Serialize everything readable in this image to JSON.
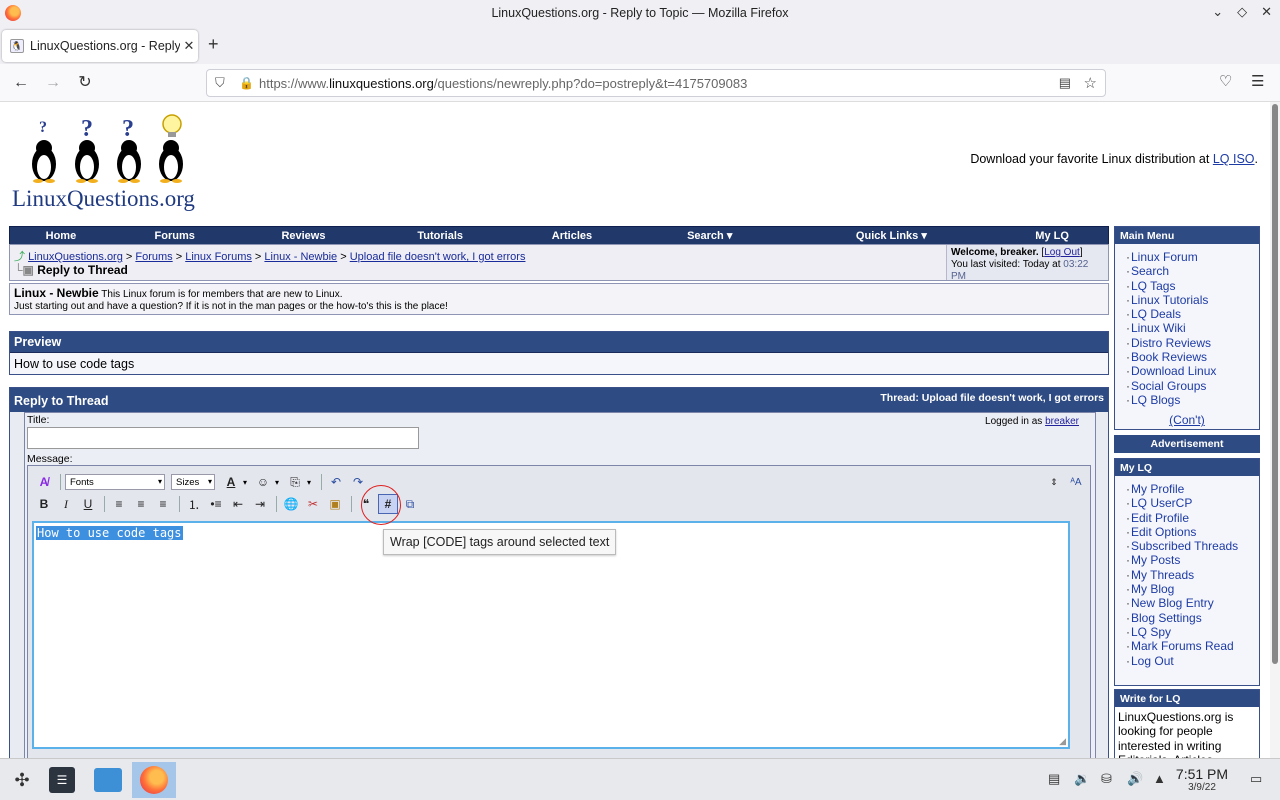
{
  "browser": {
    "window_title": "LinuxQuestions.org - Reply to Topic — Mozilla Firefox",
    "tab_title": "LinuxQuestions.org - Reply",
    "url_domain_prefix": "https://www.",
    "url_domain": "linuxquestions.org",
    "url_path": "/questions/newreply.php?do=postreply&t=4175709083"
  },
  "header": {
    "logo_text": "LinuxQuestions.org",
    "iso_prefix": "Download your favorite Linux distribution at ",
    "iso_link": "LQ ISO",
    "iso_suffix": "."
  },
  "mainnav": [
    "Home",
    "Forums",
    "Reviews",
    "Tutorials",
    "Articles",
    "Search ▾",
    "Quick Links ▾",
    "My LQ"
  ],
  "breadcrumb": {
    "items": [
      "LinuxQuestions.org",
      "Forums",
      "Linux Forums",
      "Linux - Newbie",
      "Upload file doesn't work, I got errors"
    ],
    "sep": " > ",
    "current": "Reply to Thread"
  },
  "welcome": {
    "label": "Welcome, breaker.",
    "logout": "Log Out",
    "last_visited_label": "You last visited: Today at ",
    "last_visited_time": "03:22 PM"
  },
  "forum": {
    "name": "Linux - Newbie",
    "desc1": " This Linux forum is for members that are new to Linux.",
    "desc2": "Just starting out and have a question? If it is not in the man pages or the how-to's this is the place!"
  },
  "preview": {
    "title": "Preview",
    "text": "How to use code tags"
  },
  "reply": {
    "title": "Reply to Thread",
    "thread_label": "Thread: Upload file doesn't work, I got errors",
    "title_label": "Title:",
    "logged_in_as": "Logged in as ",
    "username": "breaker",
    "message_label": "Message:",
    "fonts_select": "Fonts",
    "sizes_select": "Sizes",
    "message_text": "How to use code tags",
    "tooltip": "Wrap [CODE] tags around selected text"
  },
  "sidebar": {
    "main_menu_title": "Main Menu",
    "main_menu": [
      "Linux Forum",
      "Search",
      "LQ Tags",
      "Linux Tutorials",
      "LQ Deals",
      "Linux Wiki",
      "Distro Reviews",
      "Book Reviews",
      "Download Linux",
      "Social Groups",
      "LQ Blogs"
    ],
    "cont": "(Con't)",
    "ad_title": "Advertisement",
    "mylq_title": "My LQ",
    "mylq": [
      "My Profile",
      "LQ UserCP",
      "Edit Profile",
      "Edit Options",
      "Subscribed Threads",
      "My Posts",
      "My Threads",
      "My Blog",
      "New Blog Entry",
      "Blog Settings",
      "LQ Spy",
      "Mark Forums Read",
      "Log Out"
    ],
    "write_title": "Write for LQ",
    "write_text": "LinuxQuestions.org is looking for people interested in writing Editorials, Articles,"
  },
  "taskbar": {
    "time": "7:51 PM",
    "date": "3/9/22"
  }
}
